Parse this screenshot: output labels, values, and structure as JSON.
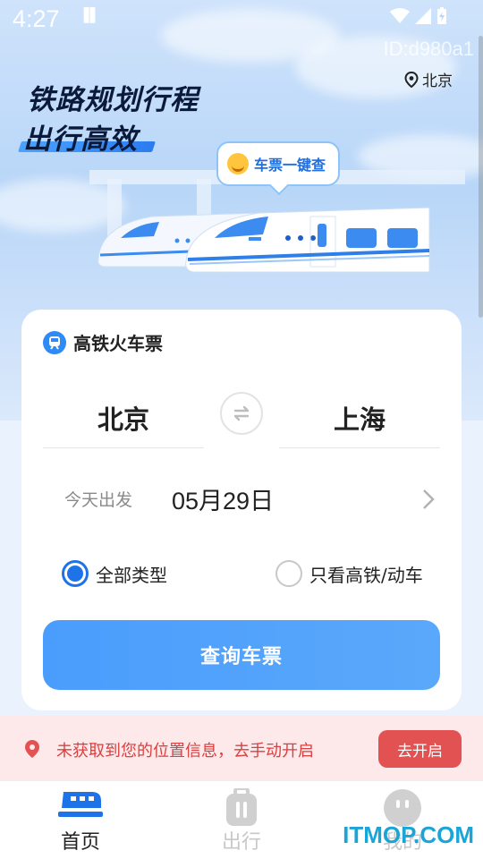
{
  "status_bar": {
    "time": "4:27",
    "dnd_glyph": "▐▌"
  },
  "header": {
    "device_id": "ID:d980a1",
    "location": "北京"
  },
  "banner": {
    "slogan_line1": "铁路规划行程",
    "slogan_line2": "出行高效",
    "bubble_text": "车票一键查"
  },
  "card": {
    "title": "高铁火车票",
    "from_city": "北京",
    "to_city": "上海",
    "date_hint": "今天出发",
    "date_value": "05月29日",
    "options": [
      {
        "label": "全部类型",
        "selected": true
      },
      {
        "label": "只看高铁/动车",
        "selected": false
      }
    ],
    "search_label": "查询车票"
  },
  "location_notice": {
    "text": "未获取到您的位置信息，去手动开启",
    "button_label": "去开启"
  },
  "bottom_nav": [
    {
      "label": "首页",
      "active": true,
      "icon": "train-icon"
    },
    {
      "label": "出行",
      "active": false,
      "icon": "luggage-icon"
    },
    {
      "label": "我的",
      "active": false,
      "icon": "profile-icon"
    }
  ],
  "watermark": "ITMOP.COM",
  "colors": {
    "primary": "#1e73e8",
    "button": "#4a9dfc",
    "alert": "#e35252",
    "alert_bg": "#fde8ea"
  }
}
